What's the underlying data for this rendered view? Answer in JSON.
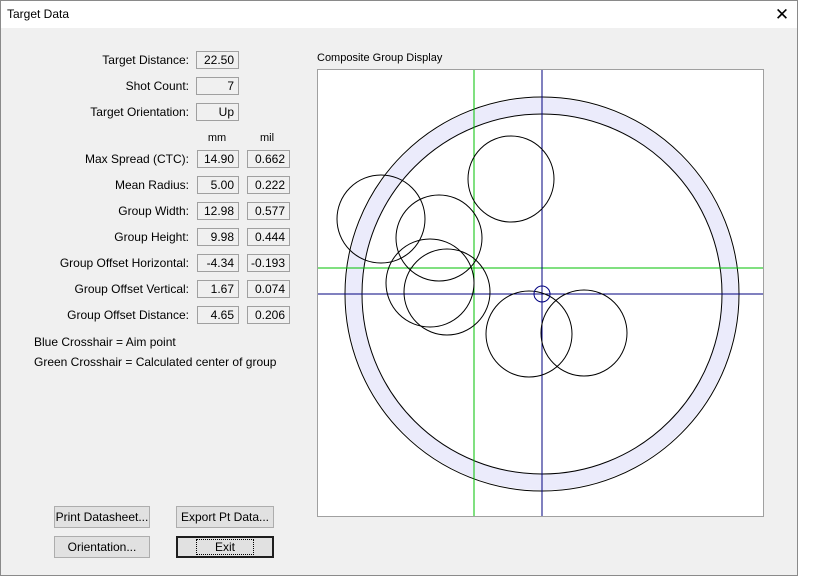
{
  "window": {
    "title": "Target Data",
    "close_glyph": "✕"
  },
  "fields": {
    "target_distance": {
      "label": "Target Distance:",
      "value": "22.50"
    },
    "shot_count": {
      "label": "Shot Count:",
      "value": "7"
    },
    "target_orientation": {
      "label": "Target Orientation:",
      "value": "Up"
    }
  },
  "columns": {
    "mm": "mm",
    "mil": "mil"
  },
  "stats": [
    {
      "label": "Max Spread (CTC):",
      "mm": "14.90",
      "mil": "0.662"
    },
    {
      "label": "Mean Radius:",
      "mm": "5.00",
      "mil": "0.222"
    },
    {
      "label": "Group Width:",
      "mm": "12.98",
      "mil": "0.577"
    },
    {
      "label": "Group Height:",
      "mm": "9.98",
      "mil": "0.444"
    },
    {
      "label": "Group Offset Horizontal:",
      "mm": "-4.34",
      "mil": "-0.193"
    },
    {
      "label": "Group Offset Vertical:",
      "mm": "1.67",
      "mil": "0.074"
    },
    {
      "label": "Group Offset Distance:",
      "mm": "4.65",
      "mil": "0.206"
    }
  ],
  "legend": {
    "blue": "Blue Crosshair = Aim point",
    "green": "Green Crosshair = Calculated center of group"
  },
  "buttons": {
    "print_datasheet": "Print Datasheet...",
    "export_pt_data": "Export Pt Data...",
    "orientation": "Orientation...",
    "exit": "Exit"
  },
  "display": {
    "label": "Composite Group Display",
    "colors": {
      "aim_crosshair": "#00007f",
      "center_crosshair": "#00c000",
      "ring_fill": "#ebebfb",
      "circle_stroke": "#000000"
    }
  }
}
